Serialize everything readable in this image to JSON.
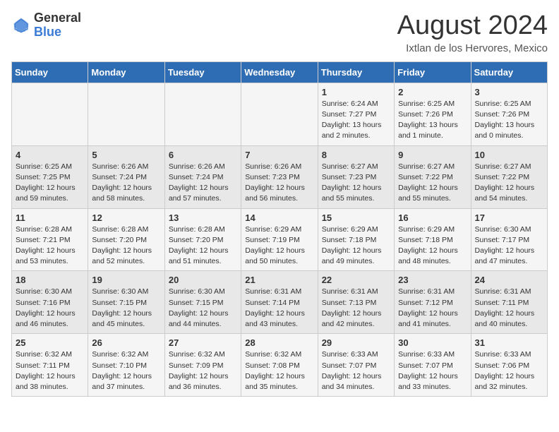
{
  "header": {
    "logo_general": "General",
    "logo_blue": "Blue",
    "month_year": "August 2024",
    "location": "Ixtlan de los Hervores, Mexico"
  },
  "days_of_week": [
    "Sunday",
    "Monday",
    "Tuesday",
    "Wednesday",
    "Thursday",
    "Friday",
    "Saturday"
  ],
  "weeks": [
    [
      {
        "day": "",
        "info": ""
      },
      {
        "day": "",
        "info": ""
      },
      {
        "day": "",
        "info": ""
      },
      {
        "day": "",
        "info": ""
      },
      {
        "day": "1",
        "info": "Sunrise: 6:24 AM\nSunset: 7:27 PM\nDaylight: 13 hours\nand 2 minutes."
      },
      {
        "day": "2",
        "info": "Sunrise: 6:25 AM\nSunset: 7:26 PM\nDaylight: 13 hours\nand 1 minute."
      },
      {
        "day": "3",
        "info": "Sunrise: 6:25 AM\nSunset: 7:26 PM\nDaylight: 13 hours\nand 0 minutes."
      }
    ],
    [
      {
        "day": "4",
        "info": "Sunrise: 6:25 AM\nSunset: 7:25 PM\nDaylight: 12 hours\nand 59 minutes."
      },
      {
        "day": "5",
        "info": "Sunrise: 6:26 AM\nSunset: 7:24 PM\nDaylight: 12 hours\nand 58 minutes."
      },
      {
        "day": "6",
        "info": "Sunrise: 6:26 AM\nSunset: 7:24 PM\nDaylight: 12 hours\nand 57 minutes."
      },
      {
        "day": "7",
        "info": "Sunrise: 6:26 AM\nSunset: 7:23 PM\nDaylight: 12 hours\nand 56 minutes."
      },
      {
        "day": "8",
        "info": "Sunrise: 6:27 AM\nSunset: 7:23 PM\nDaylight: 12 hours\nand 55 minutes."
      },
      {
        "day": "9",
        "info": "Sunrise: 6:27 AM\nSunset: 7:22 PM\nDaylight: 12 hours\nand 55 minutes."
      },
      {
        "day": "10",
        "info": "Sunrise: 6:27 AM\nSunset: 7:22 PM\nDaylight: 12 hours\nand 54 minutes."
      }
    ],
    [
      {
        "day": "11",
        "info": "Sunrise: 6:28 AM\nSunset: 7:21 PM\nDaylight: 12 hours\nand 53 minutes."
      },
      {
        "day": "12",
        "info": "Sunrise: 6:28 AM\nSunset: 7:20 PM\nDaylight: 12 hours\nand 52 minutes."
      },
      {
        "day": "13",
        "info": "Sunrise: 6:28 AM\nSunset: 7:20 PM\nDaylight: 12 hours\nand 51 minutes."
      },
      {
        "day": "14",
        "info": "Sunrise: 6:29 AM\nSunset: 7:19 PM\nDaylight: 12 hours\nand 50 minutes."
      },
      {
        "day": "15",
        "info": "Sunrise: 6:29 AM\nSunset: 7:18 PM\nDaylight: 12 hours\nand 49 minutes."
      },
      {
        "day": "16",
        "info": "Sunrise: 6:29 AM\nSunset: 7:18 PM\nDaylight: 12 hours\nand 48 minutes."
      },
      {
        "day": "17",
        "info": "Sunrise: 6:30 AM\nSunset: 7:17 PM\nDaylight: 12 hours\nand 47 minutes."
      }
    ],
    [
      {
        "day": "18",
        "info": "Sunrise: 6:30 AM\nSunset: 7:16 PM\nDaylight: 12 hours\nand 46 minutes."
      },
      {
        "day": "19",
        "info": "Sunrise: 6:30 AM\nSunset: 7:15 PM\nDaylight: 12 hours\nand 45 minutes."
      },
      {
        "day": "20",
        "info": "Sunrise: 6:30 AM\nSunset: 7:15 PM\nDaylight: 12 hours\nand 44 minutes."
      },
      {
        "day": "21",
        "info": "Sunrise: 6:31 AM\nSunset: 7:14 PM\nDaylight: 12 hours\nand 43 minutes."
      },
      {
        "day": "22",
        "info": "Sunrise: 6:31 AM\nSunset: 7:13 PM\nDaylight: 12 hours\nand 42 minutes."
      },
      {
        "day": "23",
        "info": "Sunrise: 6:31 AM\nSunset: 7:12 PM\nDaylight: 12 hours\nand 41 minutes."
      },
      {
        "day": "24",
        "info": "Sunrise: 6:31 AM\nSunset: 7:11 PM\nDaylight: 12 hours\nand 40 minutes."
      }
    ],
    [
      {
        "day": "25",
        "info": "Sunrise: 6:32 AM\nSunset: 7:11 PM\nDaylight: 12 hours\nand 38 minutes."
      },
      {
        "day": "26",
        "info": "Sunrise: 6:32 AM\nSunset: 7:10 PM\nDaylight: 12 hours\nand 37 minutes."
      },
      {
        "day": "27",
        "info": "Sunrise: 6:32 AM\nSunset: 7:09 PM\nDaylight: 12 hours\nand 36 minutes."
      },
      {
        "day": "28",
        "info": "Sunrise: 6:32 AM\nSunset: 7:08 PM\nDaylight: 12 hours\nand 35 minutes."
      },
      {
        "day": "29",
        "info": "Sunrise: 6:33 AM\nSunset: 7:07 PM\nDaylight: 12 hours\nand 34 minutes."
      },
      {
        "day": "30",
        "info": "Sunrise: 6:33 AM\nSunset: 7:07 PM\nDaylight: 12 hours\nand 33 minutes."
      },
      {
        "day": "31",
        "info": "Sunrise: 6:33 AM\nSunset: 7:06 PM\nDaylight: 12 hours\nand 32 minutes."
      }
    ]
  ]
}
